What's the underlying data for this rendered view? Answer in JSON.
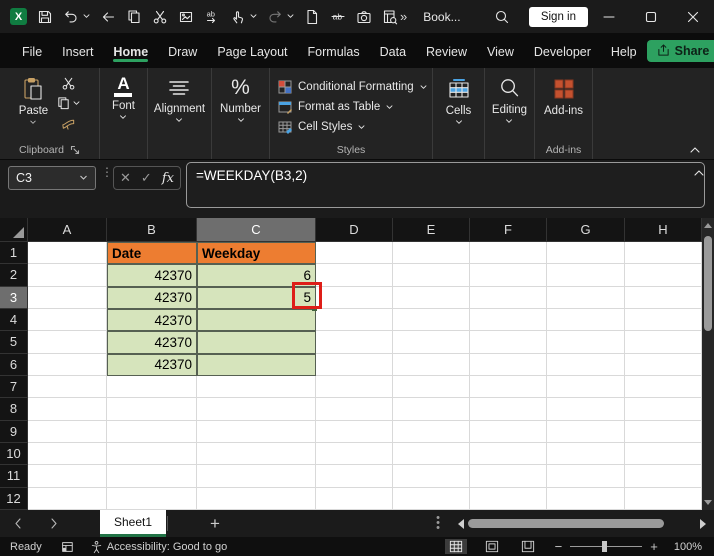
{
  "titlebar": {
    "workbook_name": "Book...",
    "signin_label": "Sign in",
    "more_commands": "»",
    "qat_icons": [
      "save",
      "undo",
      "back",
      "copy",
      "cut",
      "paste-special",
      "replace",
      "touch-mode",
      "redo",
      "new-file",
      "strikethrough",
      "camera",
      "lookup"
    ]
  },
  "ribbon": {
    "tabs": [
      {
        "label": "File",
        "active": false
      },
      {
        "label": "Insert",
        "active": false
      },
      {
        "label": "Home",
        "active": true
      },
      {
        "label": "Draw",
        "active": false
      },
      {
        "label": "Page Layout",
        "active": false
      },
      {
        "label": "Formulas",
        "active": false
      },
      {
        "label": "Data",
        "active": false
      },
      {
        "label": "Review",
        "active": false
      },
      {
        "label": "View",
        "active": false
      },
      {
        "label": "Developer",
        "active": false
      },
      {
        "label": "Help",
        "active": false
      }
    ],
    "share_label": "Share",
    "groups": {
      "clipboard": {
        "paste_label": "Paste",
        "group_label": "Clipboard"
      },
      "font": {
        "label": "Font"
      },
      "alignment": {
        "label": "Alignment"
      },
      "number": {
        "label": "Number"
      },
      "styles": {
        "items": [
          "Conditional Formatting",
          "Format as Table",
          "Cell Styles"
        ],
        "group_label": "Styles"
      },
      "cells": {
        "label": "Cells"
      },
      "editing": {
        "label": "Editing"
      },
      "addins": {
        "label": "Add-ins",
        "group_label": "Add-ins"
      }
    }
  },
  "formula_bar": {
    "name_box": "C3",
    "fx_label": "fx",
    "formula": "=WEEKDAY(B3,2)"
  },
  "grid": {
    "column_headers": [
      "A",
      "B",
      "C",
      "D",
      "E",
      "F",
      "G",
      "H"
    ],
    "row_headers": [
      "1",
      "2",
      "3",
      "4",
      "5",
      "6",
      "7",
      "8",
      "9",
      "10",
      "11",
      "12"
    ],
    "selected_column": "C",
    "selected_row": "3",
    "active_cell": "C3",
    "cells": {
      "B1": "Date",
      "C1": "Weekday",
      "B2": "42370",
      "C2": "6",
      "B3": "42370",
      "C3": "5",
      "B4": "42370",
      "B5": "42370",
      "B6": "42370"
    },
    "colors": {
      "table_header_fill": "#ED7D31",
      "table_data_fill": "#D6E4BC",
      "annotation_box": "#DE1E18",
      "accent_green": "#2DA160"
    }
  },
  "sheet_bar": {
    "tabs": [
      {
        "label": "Sheet1",
        "active": true
      }
    ]
  },
  "status_bar": {
    "mode": "Ready",
    "accessibility": "Accessibility: Good to go",
    "zoom_level": "100%"
  }
}
